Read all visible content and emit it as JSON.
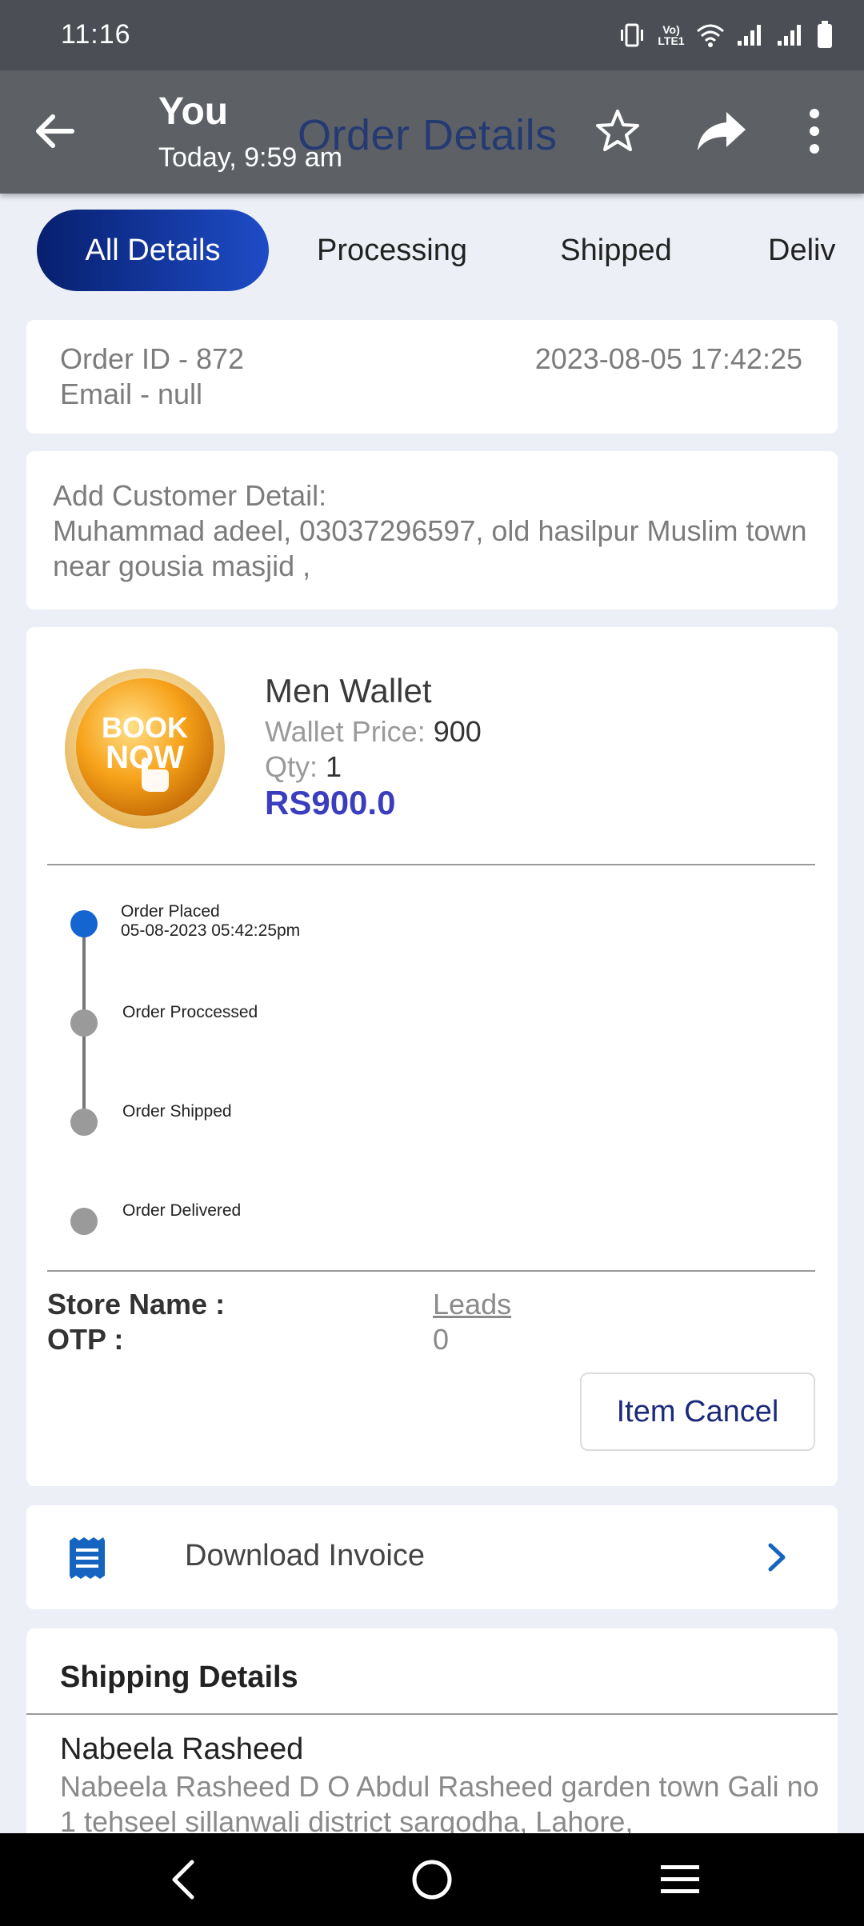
{
  "status_bar": {
    "time": "11:16",
    "volte_label": "Vo) LTE1"
  },
  "app_bar": {
    "sender_name": "You",
    "sender_time": "Today, 9:59 am",
    "background_title": "Order Details",
    "icons": [
      "back-arrow-icon",
      "star-icon",
      "share-icon",
      "more-vert-icon"
    ]
  },
  "tabs": [
    {
      "label": "All Details",
      "active": true
    },
    {
      "label": "Processing",
      "active": false
    },
    {
      "label": "Shipped",
      "active": false
    },
    {
      "label": "Deliv",
      "active": false
    }
  ],
  "order": {
    "id_text": "Order ID - 872",
    "email_text": "Email - null",
    "datetime": "2023-08-05 17:42:25"
  },
  "customer": {
    "heading": "Add Customer Detail:",
    "details": "Muhammad adeel, 03037296597, old hasilpur Muslim town near gousia masjid ,"
  },
  "product": {
    "image_text_line1": "BOOK",
    "image_text_line2": "NOW",
    "name": "Men Wallet",
    "price_label": "Wallet Price:",
    "price_value": "900",
    "qty_label": "Qty:",
    "qty_value": "1",
    "total": "RS900.0"
  },
  "timeline": [
    {
      "label": "Order Placed",
      "date": "05-08-2023 05:42:25pm",
      "done": true
    },
    {
      "label": "Order Proccessed",
      "date": "",
      "done": false
    },
    {
      "label": "Order Shipped",
      "date": "",
      "done": false
    },
    {
      "label": "Order Delivered",
      "date": "",
      "done": false
    }
  ],
  "store": {
    "name_label": "Store Name :",
    "name_value": "Leads",
    "otp_label": "OTP :",
    "otp_value": "0",
    "cancel_label": "Item Cancel"
  },
  "invoice": {
    "label": "Download Invoice"
  },
  "shipping": {
    "title": "Shipping Details",
    "name": "Nabeela Rasheed",
    "address": "Nabeela Rasheed D O Abdul Rasheed garden town Gali no 1 tehseel sillanwali district sargodha, Lahore,"
  },
  "colors": {
    "tab_active_start": "#071f6e",
    "tab_active_end": "#1e4cc7",
    "price_total": "#3b3dbf",
    "timeline_active": "#1565d0",
    "invoice_icon": "#1565c0"
  }
}
